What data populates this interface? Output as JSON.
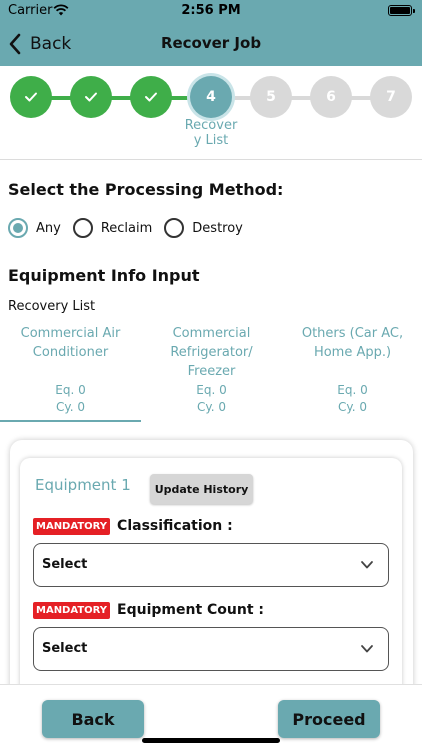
{
  "status_bar": {
    "carrier": "Carrier",
    "time": "2:56 PM"
  },
  "nav": {
    "back_label": "Back",
    "title": "Recover Job"
  },
  "stepper": {
    "steps": [
      {
        "label": "",
        "state": "done"
      },
      {
        "label": "",
        "state": "done"
      },
      {
        "label": "",
        "state": "done"
      },
      {
        "label": "4",
        "state": "active"
      },
      {
        "label": "5",
        "state": "todo"
      },
      {
        "label": "6",
        "state": "todo"
      },
      {
        "label": "7",
        "state": "todo"
      }
    ],
    "active_caption_line1": "Recover",
    "active_caption_line2": "y List"
  },
  "processing": {
    "title": "Select the Processing Method:",
    "options": [
      "Any",
      "Reclaim",
      "Destroy"
    ],
    "selected": "Any"
  },
  "equipment_info": {
    "title": "Equipment Info Input",
    "recovery_list_label": "Recovery List"
  },
  "tabs": [
    {
      "name_line1": "Commercial Air",
      "name_line2": "Conditioner",
      "name_line3": "",
      "eq": "Eq. 0",
      "cy": "Cy. 0"
    },
    {
      "name_line1": "Commercial",
      "name_line2": "Refrigerator/",
      "name_line3": "Freezer",
      "eq": "Eq. 0",
      "cy": "Cy. 0"
    },
    {
      "name_line1": "Others (Car AC,",
      "name_line2": "Home App.)",
      "name_line3": "",
      "eq": "Eq. 0",
      "cy": "Cy. 0"
    }
  ],
  "equipment_card": {
    "title": "Equipment 1",
    "history_button": "Update History",
    "mandatory_badge": "MANDATORY",
    "classification_label": "Classification :",
    "classification_value": "Select",
    "count_label": "Equipment Count :",
    "count_value": "Select"
  },
  "footer": {
    "back_button": "Back",
    "proceed_button": "Proceed"
  },
  "colors": {
    "accent": "#6aa9b0",
    "done": "#3fae49",
    "pending": "#d9d9d9",
    "mandatory": "#e52025"
  }
}
